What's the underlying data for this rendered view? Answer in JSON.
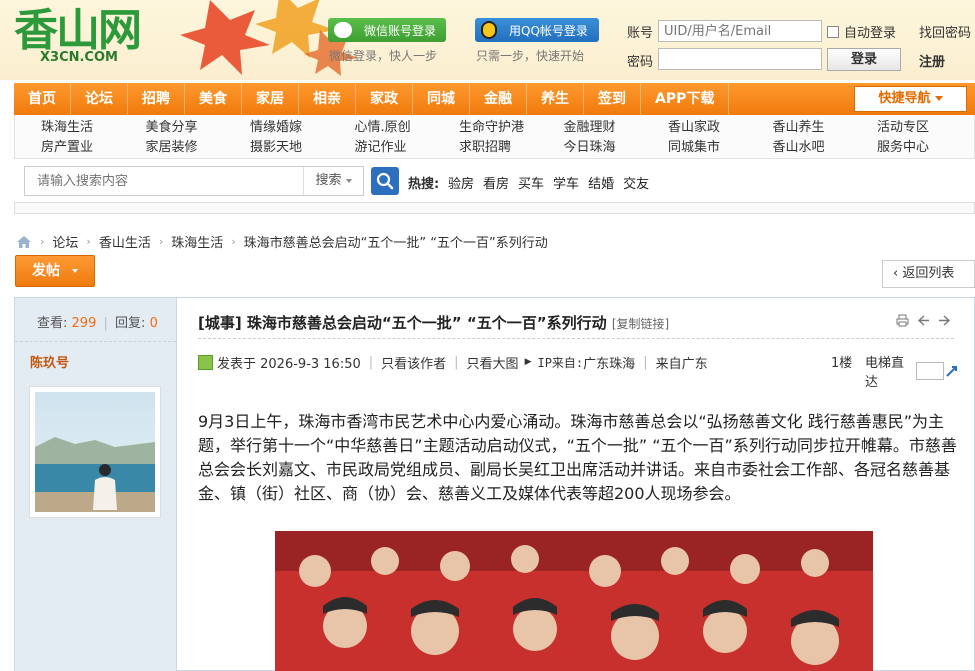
{
  "header": {
    "logo_cn": "香山网",
    "logo_en": "X3CN.COM",
    "wechat_login": "微信账号登录",
    "wechat_hint": "微信登录，快人一步",
    "qq_login": "用QQ帐号登录",
    "qq_hint": "只需一步，快速开始",
    "account_label": "账号",
    "account_placeholder": "UID/用户名/Email",
    "password_label": "密码",
    "auto_login": "自动登录",
    "find_password": "找回密码",
    "login_button": "登录",
    "register": "注册"
  },
  "nav": {
    "items": [
      "首页",
      "论坛",
      "招聘",
      "美食",
      "家居",
      "相亲",
      "家政",
      "同城",
      "金融",
      "养生",
      "签到",
      "APP下载"
    ],
    "quick_nav": "快捷导航"
  },
  "subnav": {
    "items": [
      "珠海生活",
      "美食分享",
      "情缘婚嫁",
      "心情.原创",
      "生命守护港",
      "金融理财",
      "香山家政",
      "香山养生",
      "活动专区",
      "房产置业",
      "家居装修",
      "摄影天地",
      "游记作业",
      "求职招聘",
      "今日珠海",
      "同城集市",
      "香山水吧",
      "服务中心"
    ]
  },
  "search": {
    "placeholder": "请输入搜索内容",
    "scope": "搜索",
    "hot_label": "热搜:",
    "hot_items": [
      "验房",
      "看房",
      "买车",
      "学车",
      "结婚",
      "交友"
    ]
  },
  "breadcrumb": [
    "论坛",
    "香山生活",
    "珠海生活",
    "珠海市慈善总会启动“五个一批” “五个一百”系列行动"
  ],
  "actions": {
    "post_button": "发帖",
    "back_to_list": "返回列表"
  },
  "post": {
    "views_label": "查看:",
    "views": "299",
    "replies_label": "回复:",
    "replies": "0",
    "author": "陈玖号",
    "title": "[城事] 珠海市慈善总会启动“五个一批” “五个一百”系列行动",
    "copy_link": "[复制链接]",
    "posted_at": "发表于 2026-9-3 16:50",
    "only_author": "只看该作者",
    "big_image": "只看大图",
    "ip_label": "IP来自:",
    "ip_location": "广东珠海",
    "from": "来自广东",
    "floor": "1楼",
    "elevator": "电梯直达",
    "content": "9月3日上午，珠海市香湾市民艺术中心内爱心涌动。珠海市慈善总会以“弘扬慈善文化 践行慈善惠民”为主题，举行第十一个“中华慈善日”主题活动启动仪式，“五个一批” “五个一百”系列行动同步拉开帷幕。市慈善总会会长刘嘉文、市民政局党组成员、副局长吴红卫出席活动并讲话。来自市委社会工作部、各冠名慈善基金、镇（街）社区、商（协）会、慈善义工及媒体代表等超200人现场参会。"
  },
  "colors": {
    "nav_orange": "#f28a1e",
    "accent_orange": "#f26c12",
    "logo_green": "#2c9a3a",
    "side_blue": "#e4ecf3"
  }
}
